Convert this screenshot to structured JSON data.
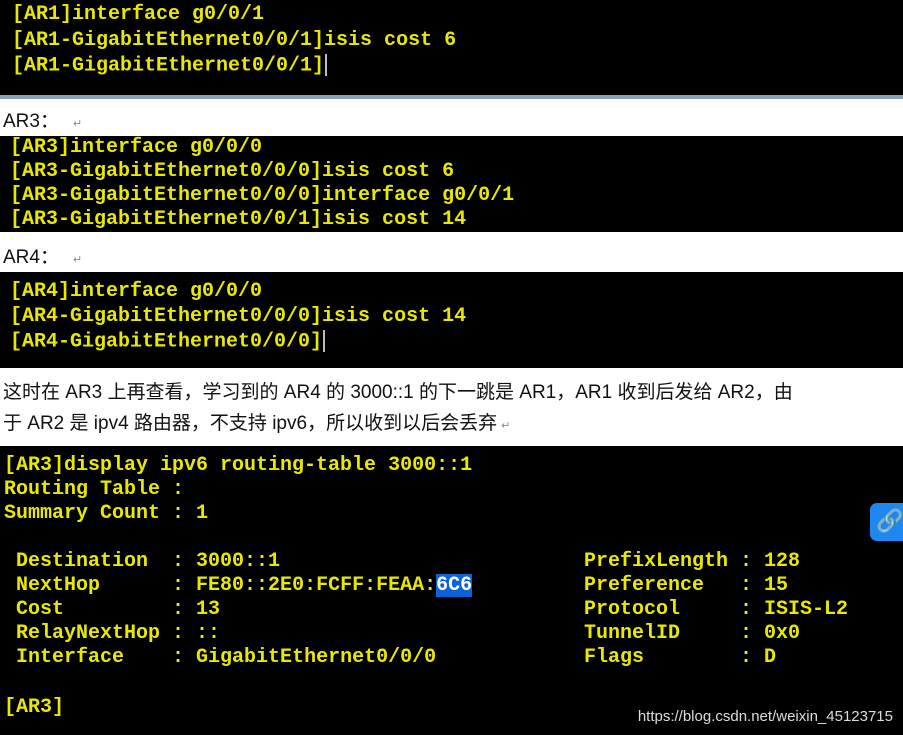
{
  "terminal_ar1": {
    "lines": [
      "[AR1]interface g0/0/1",
      "[AR1-GigabitEthernet0/0/1]isis cost 6",
      "[AR1-GigabitEthernet0/0/1]"
    ]
  },
  "caption_ar3": "AR3：",
  "terminal_ar3": {
    "lines": [
      "[AR3]interface g0/0/0",
      "[AR3-GigabitEthernet0/0/0]isis cost 6",
      "[AR3-GigabitEthernet0/0/0]interface g0/0/1",
      "[AR3-GigabitEthernet0/0/1]isis cost 14"
    ]
  },
  "caption_ar4": "AR4：",
  "terminal_ar4": {
    "lines": [
      "[AR4]interface g0/0/0",
      "[AR4-GigabitEthernet0/0/0]isis cost 14",
      "[AR4-GigabitEthernet0/0/0]"
    ]
  },
  "paragraph": {
    "line1": "这时在 AR3 上再查看，学习到的 AR4 的 3000::1 的下一跳是 AR1，AR1 收到后发给 AR2，由",
    "line2": "于 AR2 是 ipv4 路由器，不支持 ipv6，所以收到以后会丢弃"
  },
  "terminal_route": {
    "command": "[AR3]display ipv6 routing-table 3000::1",
    "routing_table": "Routing Table :",
    "summary": "Summary Count : 1",
    "left": [
      {
        "label": "Destination  ",
        "value": "3000::1"
      },
      {
        "label": "NextHop      ",
        "value": "FE80::2E0:FCFF:FEAA:",
        "selected": "6C6"
      },
      {
        "label": "Cost         ",
        "value": "13"
      },
      {
        "label": "RelayNextHop ",
        "value": "::"
      },
      {
        "label": "Interface    ",
        "value": "GigabitEthernet0/0/0"
      }
    ],
    "right": [
      {
        "label": "PrefixLength ",
        "value": "128"
      },
      {
        "label": "Preference   ",
        "value": "15"
      },
      {
        "label": "Protocol     ",
        "value": "ISIS-L2"
      },
      {
        "label": "TunnelID     ",
        "value": "0x0"
      },
      {
        "label": "Flags        ",
        "value": "D"
      }
    ],
    "prompt": "[AR3]"
  },
  "watermark": "https://blog.csdn.net/weixin_45123715",
  "float_icon": "link-icon"
}
